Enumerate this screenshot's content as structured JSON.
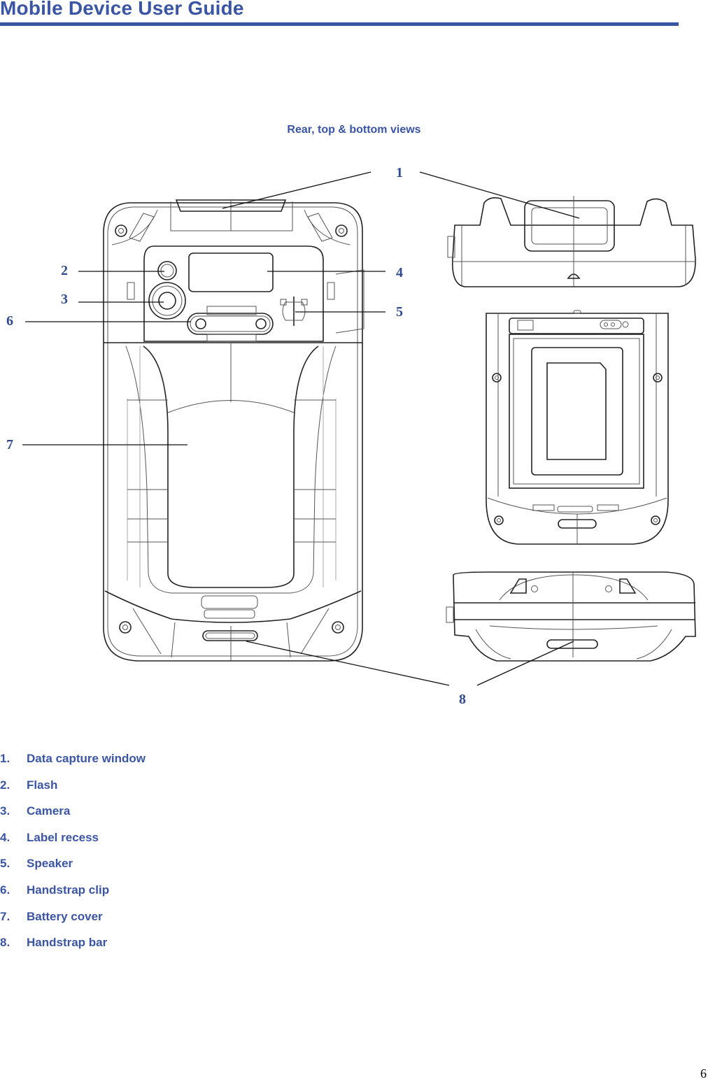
{
  "header": {
    "title": "Mobile Device User Guide",
    "accent_color": "#3a55a4"
  },
  "figure": {
    "caption": "Rear, top & bottom views",
    "callouts": [
      "1",
      "2",
      "3",
      "4",
      "5",
      "6",
      "7",
      "8"
    ],
    "views": [
      "rear-view",
      "top-view",
      "battery-compartment-view",
      "bottom-view"
    ]
  },
  "parts": [
    {
      "number": "1.",
      "label": "Data capture window"
    },
    {
      "number": "2.",
      "label": "Flash"
    },
    {
      "number": "3.",
      "label": "Camera"
    },
    {
      "number": "4.",
      "label": "Label recess"
    },
    {
      "number": "5.",
      "label": "Speaker"
    },
    {
      "number": "6.",
      "label": "Handstrap clip"
    },
    {
      "number": "7.",
      "label": "Battery cover"
    },
    {
      "number": "8.",
      "label": "Handstrap bar"
    }
  ],
  "footer": {
    "page_number": "6"
  }
}
